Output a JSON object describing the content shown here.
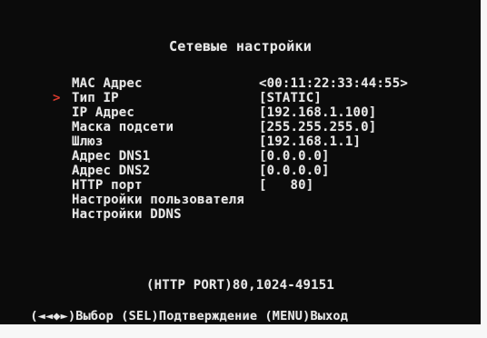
{
  "menu": {
    "title": "Сетевые настройки",
    "selection_marker": ">",
    "selected_item": "ip-type",
    "items": [
      {
        "label": "MAC Адрес",
        "value": "<00:11:22:33:44:55>"
      },
      {
        "label": "Тип IP",
        "value": "[STATIC]"
      },
      {
        "label": "IP Адрес",
        "value": "[192.168.1.100]"
      },
      {
        "label": "Маска подсети",
        "value": "[255.255.255.0]"
      },
      {
        "label": "Шлюз",
        "value": "[192.168.1.1]"
      },
      {
        "label": "Адрес DNS1",
        "value": "[0.0.0.0]"
      },
      {
        "label": "Адрес DNS2",
        "value": "[0.0.0.0]"
      },
      {
        "label": "HTTP порт",
        "value": "[   80]"
      },
      {
        "label": "Настройки пользователя",
        "value": ""
      },
      {
        "label": "Настройки DDNS",
        "value": ""
      }
    ]
  },
  "hint": {
    "port_range": "(HTTP PORT)80,1024-49151"
  },
  "footer": {
    "nav_icon": "(◄◄◆►)",
    "select_label": "Выбор",
    "confirm_key": "(SEL)",
    "confirm_label": "Подтверждение",
    "exit_key": "(MENU)",
    "exit_label": "Выход"
  },
  "colors": {
    "background": "#0b0b0b",
    "text": "#e6e6e6",
    "marker": "#d83a2e"
  }
}
